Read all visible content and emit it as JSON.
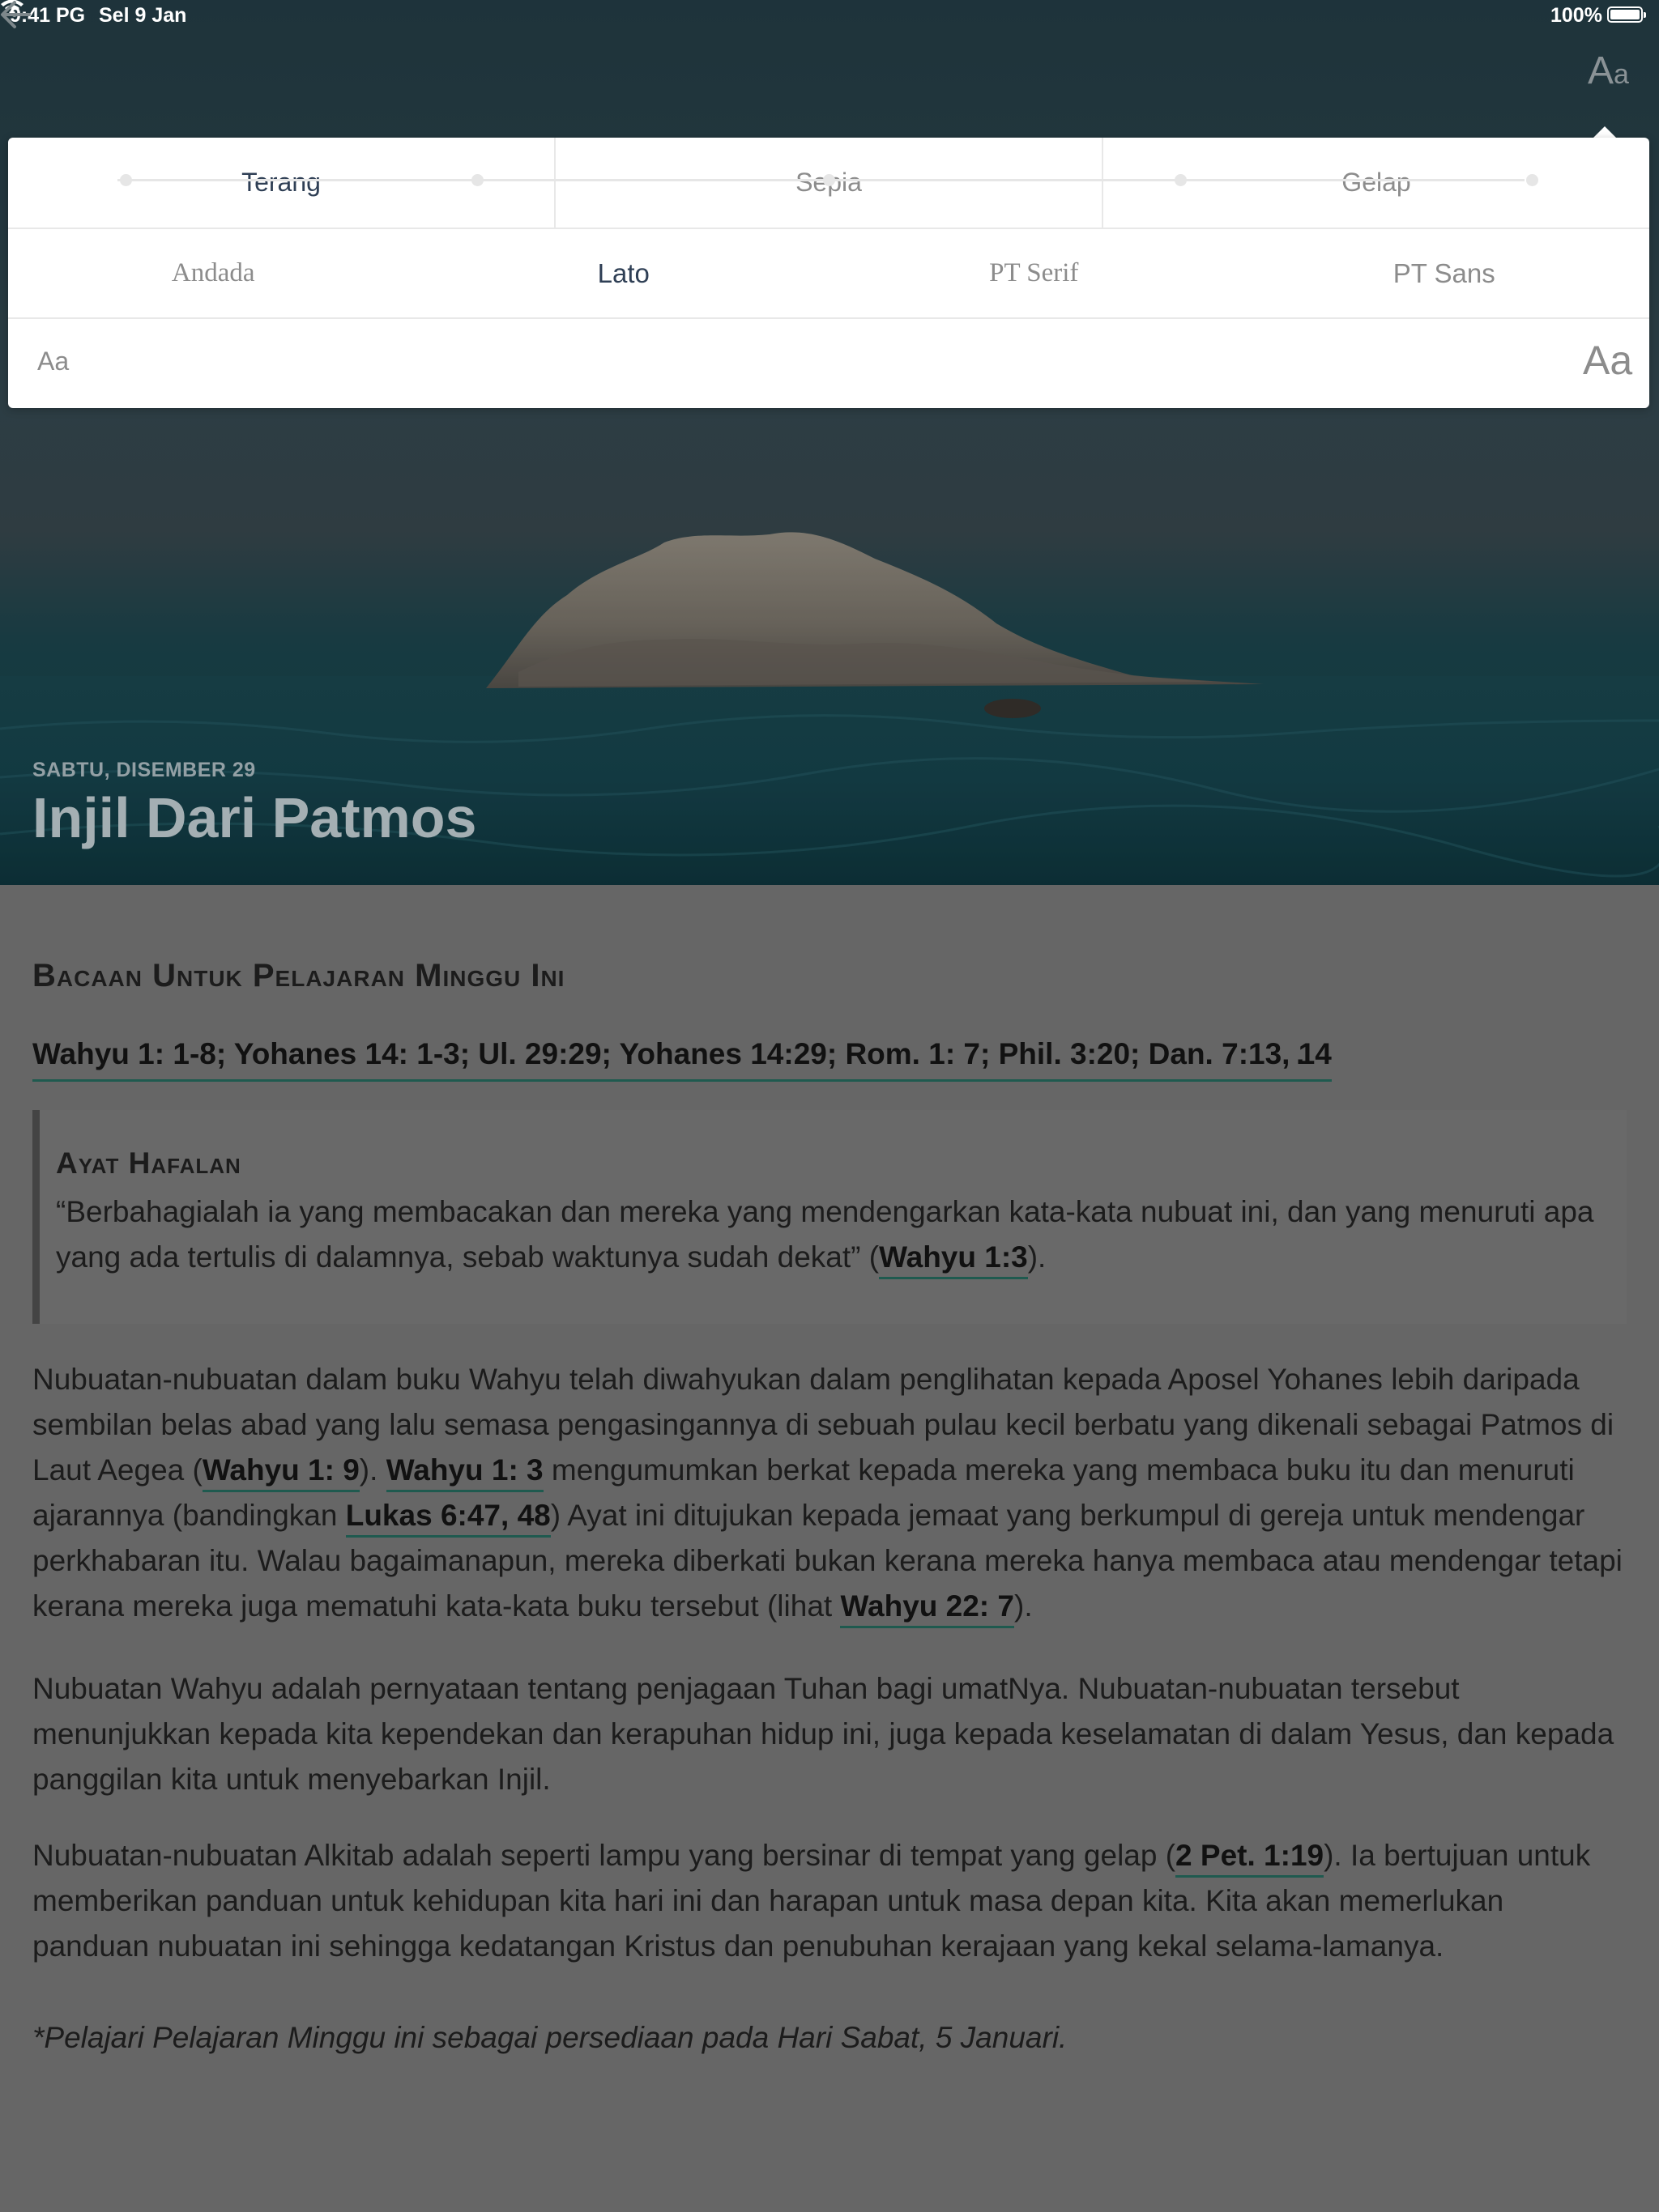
{
  "status_bar": {
    "time": "9:41 PG",
    "date": "Sel 9 Jan",
    "battery": "100%"
  },
  "nav": {
    "back_icon": "arrow-left-icon",
    "settings_icon": "text-size-icon",
    "settings_label_big": "A",
    "settings_label_small": "a"
  },
  "display_settings": {
    "themes": [
      "Terang",
      "Sepia",
      "Gelap"
    ],
    "selected_theme": "Terang",
    "fonts": [
      "Andada",
      "Lato",
      "PT Serif",
      "PT Sans"
    ],
    "selected_font": "Lato",
    "size_small_label": "Aa",
    "size_large_label": "Aa",
    "font_size_steps": 5,
    "font_size_selected_step": 0
  },
  "lesson": {
    "date": "SABTU, DISEMBER 29",
    "title": "Injil Dari Patmos"
  },
  "content": {
    "section_heading": "Bacaan Untuk Pelajaran Minggu Ini",
    "readings": "Wahyu 1: 1-8; Yohanes 14: 1-3; Ul. 29:29; Yohanes 14:29; Rom. 1: 7; Phil. 3:20; Dan. 7:13, 14",
    "memory_verse": {
      "title": "Ayat Hafalan",
      "text": "“Berbahagialah ia yang membacakan dan mereka yang mendengarkan kata-kata nubuat ini, dan yang menuruti apa yang ada tertulis di dalamnya, sebab waktunya sudah dekat” (",
      "ref": "Wahyu 1:3",
      "end": ")."
    },
    "p1": {
      "t1": "Nubuatan-nubuatan dalam buku Wahyu telah diwahyukan dalam penglihatan kepada Aposel Yohanes lebih daripada sembilan belas abad yang lalu semasa pengasingannya di sebuah pulau kecil berbatu yang dikenali sebagai Patmos di Laut Aegea (",
      "r1": "Wahyu 1: 9",
      "t2": "). ",
      "r2": "Wahyu 1: 3",
      "t3": " mengumumkan berkat kepada mereka yang membaca buku itu dan menuruti ajarannya (bandingkan ",
      "r3": "Lukas 6:47, 48",
      "t4": ") Ayat ini ditujukan kepada jemaat yang berkumpul di gereja untuk mendengar perkhabaran itu. Walau bagaimanapun, mereka diberkati bukan kerana mereka hanya membaca atau mendengar tetapi kerana mereka juga mematuhi kata-kata buku tersebut (lihat ",
      "r4": "Wahyu 22: 7",
      "t5": ")."
    },
    "p2": "Nubuatan Wahyu adalah pernyataan tentang penjagaan Tuhan bagi umatNya. Nubuatan-nubuatan tersebut menunjukkan kepada kita kependekan dan kerapuhan hidup ini, juga kepada keselamatan di dalam Yesus, dan kepada panggilan kita untuk menyebarkan Injil.",
    "p3": {
      "t1": "Nubuatan-nubuatan Alkitab adalah seperti lampu yang bersinar di tempat yang gelap (",
      "r1": "2 Pet. 1:19",
      "t2": "). Ia bertujuan untuk memberikan panduan untuk kehidupan kita hari ini dan harapan untuk masa depan kita. Kita akan memerlukan panduan nubuatan ini sehingga kedatangan Kristus dan penubuhan kerajaan yang kekal selama-lamanya."
    },
    "note": "*Pelajari Pelajaran Minggu ini sebagai persediaan pada Hari Sabat, 5 Januari."
  }
}
